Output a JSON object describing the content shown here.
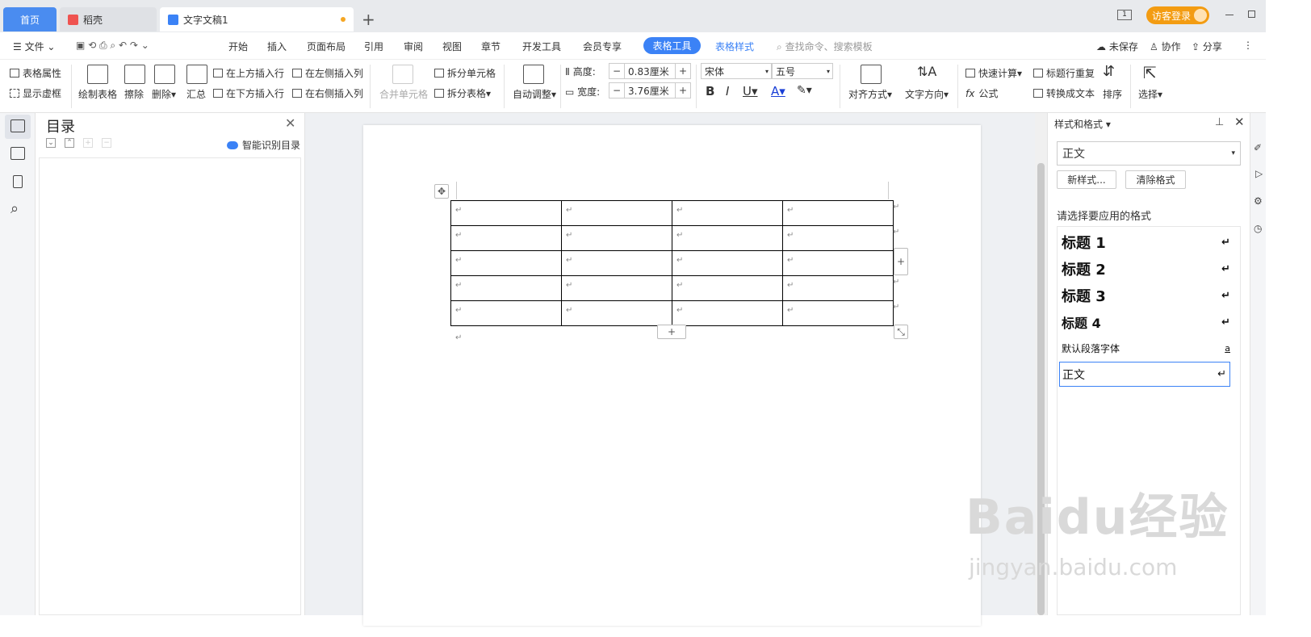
{
  "tabs": {
    "home": "首页",
    "daoke": "稻壳",
    "doc": "文字文稿1"
  },
  "login": "访客登录",
  "menu": {
    "file": "文件",
    "items": [
      "开始",
      "插入",
      "页面布局",
      "引用",
      "审阅",
      "视图",
      "章节",
      "开发工具",
      "会员专享"
    ],
    "table_tools": "表格工具",
    "table_style": "表格样式",
    "search": "查找命令、搜索模板",
    "unsaved": "未保存",
    "collab": "协作",
    "share": "分享"
  },
  "ribbon": {
    "table_props": "表格属性",
    "show_grid": "显示虚框",
    "draw_table": "绘制表格",
    "erase": "擦除",
    "delete": "删除",
    "summary": "汇总",
    "insert_above": "在上方插入行",
    "insert_below": "在下方插入行",
    "insert_left": "在左侧插入列",
    "insert_right": "在右侧插入列",
    "merge": "合并单元格",
    "split_cell": "拆分单元格",
    "split_table": "拆分表格",
    "auto_adjust": "自动调整",
    "height_label": "高度:",
    "height_value": "0.83厘米",
    "width_label": "宽度:",
    "width_value": "3.76厘米",
    "font": "宋体",
    "size": "五号",
    "align": "对齐方式",
    "text_dir": "文字方向",
    "quick_calc": "快速计算",
    "repeat_header": "标题行重复",
    "formula": "公式",
    "to_text": "转换成文本",
    "sort": "排序",
    "select": "选择"
  },
  "toc": {
    "title": "目录",
    "smart": "智能识别目录"
  },
  "table": {
    "rows": 5,
    "cols": 4,
    "mark": "↵"
  },
  "styles_panel": {
    "title": "样式和格式",
    "current": "正文",
    "new_style": "新样式...",
    "clear": "清除格式",
    "prompt": "请选择要应用的格式",
    "items": [
      "标题 1",
      "标题 2",
      "标题 3",
      "标题 4",
      "默认段落字体",
      "正文"
    ]
  },
  "watermark": {
    "main": "Baidu经验",
    "sub": "jingyan.baidu.com"
  }
}
